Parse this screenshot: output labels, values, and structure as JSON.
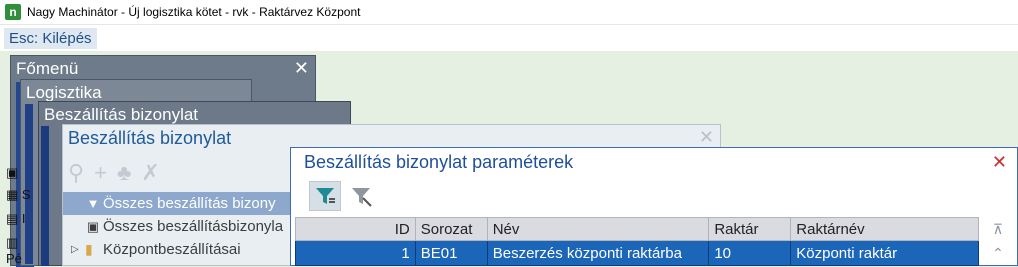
{
  "titlebar": {
    "icon_text": "n",
    "title": "Nagy Machinátor - Új logisztika kötet - rvk - Raktárvez Központ"
  },
  "menubar": {
    "esc": "Esc: Kilépés"
  },
  "windows": {
    "fomenu": {
      "title": "Főmenü",
      "close": "✕"
    },
    "logisztika": {
      "title": "Logisztika"
    },
    "beszallitas": {
      "title": "Beszállítás bizonylat",
      "close": "✕"
    },
    "beszallitas2": {
      "title": "Beszállítás bizonylat",
      "close": "✕"
    },
    "parameterek": {
      "title": "Beszállítás bizonylat paraméterek",
      "close": "✕"
    }
  },
  "side_items": [
    "S",
    "I",
    "Pé"
  ],
  "tree": [
    {
      "label": "Összes beszállítás bizony",
      "selected": true
    },
    {
      "label": "Összes beszállításbizonyla",
      "selected": false
    },
    {
      "label": "Központbeszállításai",
      "selected": false
    }
  ],
  "grid": {
    "columns": [
      "ID",
      "Sorozat",
      "Név",
      "Raktár",
      "Raktárnév"
    ],
    "rows": [
      {
        "id": "1",
        "sorozat": "BE01",
        "nev": "Beszerzés központi raktárba",
        "raktar": "10",
        "raktarnev": "Központi raktár"
      }
    ]
  }
}
